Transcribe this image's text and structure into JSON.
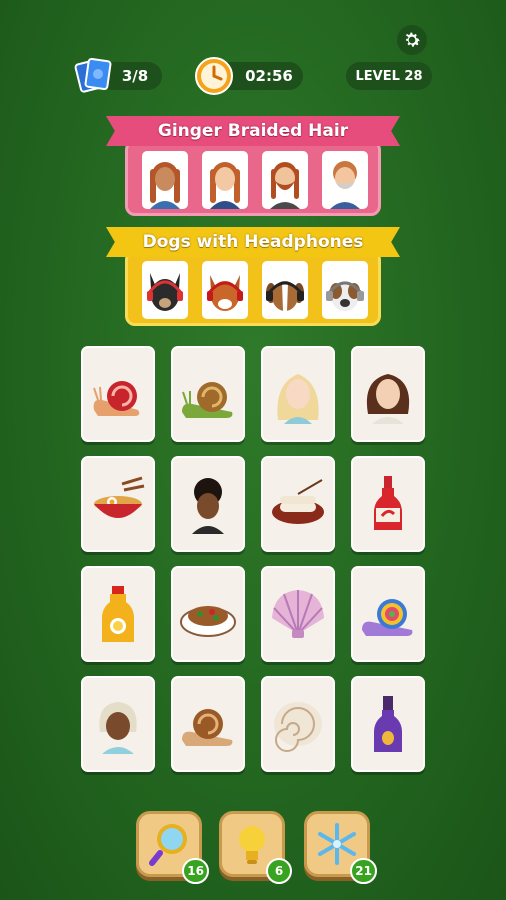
{
  "hud": {
    "cards_count": "3/8",
    "timer": "02:56",
    "level": "LEVEL 28"
  },
  "categories": [
    {
      "title": "Ginger Braided Hair",
      "color": "#e8678b",
      "items": [
        "woman-braids-1",
        "woman-braids-2",
        "man-braids-beard",
        "older-man-beard"
      ]
    },
    {
      "title": "Dogs with Headphones",
      "color": "#f2c21a",
      "items": [
        "black-dog-headphones",
        "red-dog-headphones",
        "brown-dog-headphones",
        "grey-dog-headphones"
      ]
    }
  ],
  "tiles": [
    "red-snail",
    "green-snail",
    "blonde-woman",
    "brunette-woman",
    "ramen-bowl",
    "curly-woman",
    "sushi-rolls",
    "hot-sauce",
    "juice-bottle",
    "noodle-plate",
    "pink-shell",
    "rainbow-snail",
    "grey-haired-woman",
    "brown-snail",
    "spiral-shell",
    "purple-bottle"
  ],
  "powerups": [
    {
      "name": "magnifier-icon",
      "count": "16"
    },
    {
      "name": "lightbulb-icon",
      "count": "6"
    },
    {
      "name": "snowflake-icon",
      "count": "21"
    }
  ]
}
